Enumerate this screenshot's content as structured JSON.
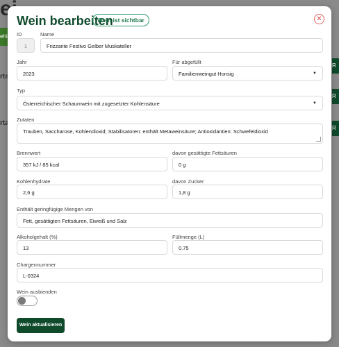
{
  "modal": {
    "title": "Wein bearbeiten",
    "badge": "Wein ist sichtbar",
    "close_icon": "close-icon"
  },
  "background": {
    "title_fragment": "ei",
    "button_fragment": "ehi",
    "row1_fragment": "rtar",
    "row2_fragment": "rtar",
    "right_fragment1": "R C",
    "right_fragment2": "R C",
    "right_fragment3": "R C"
  },
  "form": {
    "id": {
      "label": "ID",
      "value": "1"
    },
    "name": {
      "label": "Name",
      "value": "Frizzante Festivo Gelber Muskateller"
    },
    "jahr": {
      "label": "Jahr",
      "value": "2023"
    },
    "abgefuellt": {
      "label": "Für abgefüllt",
      "value": "Familienweingut Honsig"
    },
    "typ": {
      "label": "Typ",
      "value": "Österreichischer Schaumwein mit zugesetzter Kohlensäure"
    },
    "zutaten": {
      "label": "Zutaten",
      "value": "Trauben, Saccharose, Kohlendioxid; Stabilisatoren: enthält Metaweinsäure; Antioxidantien: Schwefeldioxid"
    },
    "brennwert": {
      "label": "Brennwert",
      "value": "357 kJ / 85 kcal"
    },
    "fettsaeuren": {
      "label": "davon gesättigte Fettsäuren",
      "value": "0 g"
    },
    "kohlenhydrate": {
      "label": "Kohlenhydrate",
      "value": "2,6 g"
    },
    "zucker": {
      "label": "davon Zucker",
      "value": "1,8 g"
    },
    "mengen": {
      "label": "Enthält geringfügige Mengen von",
      "value": "Fett, gesättigten Fettsäuren, Eiweiß und Salz"
    },
    "alkohol": {
      "label": "Alkoholgehalt (%)",
      "value": "13"
    },
    "fuellmenge": {
      "label": "Füllmenge (L)",
      "value": "0.75"
    },
    "charge": {
      "label": "Chargennummer",
      "value": "L-0324"
    },
    "ausblenden": {
      "label": "Wein ausbienden",
      "on": false
    }
  },
  "submit_label": "Wein aktualisieren",
  "colors": {
    "brand": "#0f4a2b",
    "badge": "#1f7a4f",
    "close": "#d84a4a"
  }
}
